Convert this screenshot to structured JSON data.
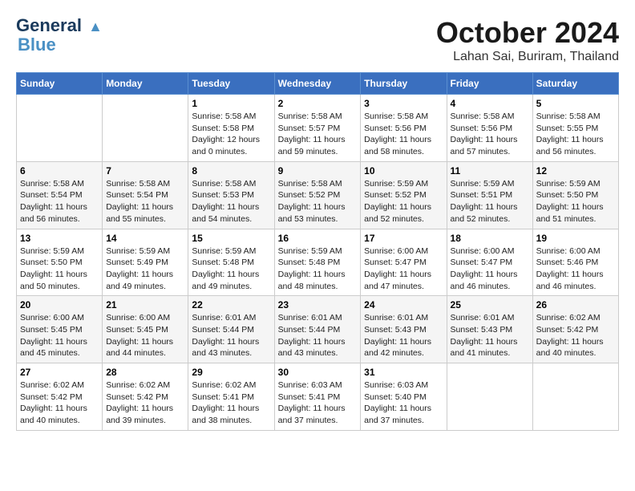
{
  "logo": {
    "line1": "General",
    "line2": "Blue"
  },
  "title": "October 2024",
  "location": "Lahan Sai, Buriram, Thailand",
  "days_of_week": [
    "Sunday",
    "Monday",
    "Tuesday",
    "Wednesday",
    "Thursday",
    "Friday",
    "Saturday"
  ],
  "weeks": [
    [
      {
        "day": "",
        "content": ""
      },
      {
        "day": "",
        "content": ""
      },
      {
        "day": "1",
        "content": "Sunrise: 5:58 AM\nSunset: 5:58 PM\nDaylight: 12 hours\nand 0 minutes."
      },
      {
        "day": "2",
        "content": "Sunrise: 5:58 AM\nSunset: 5:57 PM\nDaylight: 11 hours\nand 59 minutes."
      },
      {
        "day": "3",
        "content": "Sunrise: 5:58 AM\nSunset: 5:56 PM\nDaylight: 11 hours\nand 58 minutes."
      },
      {
        "day": "4",
        "content": "Sunrise: 5:58 AM\nSunset: 5:56 PM\nDaylight: 11 hours\nand 57 minutes."
      },
      {
        "day": "5",
        "content": "Sunrise: 5:58 AM\nSunset: 5:55 PM\nDaylight: 11 hours\nand 56 minutes."
      }
    ],
    [
      {
        "day": "6",
        "content": "Sunrise: 5:58 AM\nSunset: 5:54 PM\nDaylight: 11 hours\nand 56 minutes."
      },
      {
        "day": "7",
        "content": "Sunrise: 5:58 AM\nSunset: 5:54 PM\nDaylight: 11 hours\nand 55 minutes."
      },
      {
        "day": "8",
        "content": "Sunrise: 5:58 AM\nSunset: 5:53 PM\nDaylight: 11 hours\nand 54 minutes."
      },
      {
        "day": "9",
        "content": "Sunrise: 5:58 AM\nSunset: 5:52 PM\nDaylight: 11 hours\nand 53 minutes."
      },
      {
        "day": "10",
        "content": "Sunrise: 5:59 AM\nSunset: 5:52 PM\nDaylight: 11 hours\nand 52 minutes."
      },
      {
        "day": "11",
        "content": "Sunrise: 5:59 AM\nSunset: 5:51 PM\nDaylight: 11 hours\nand 52 minutes."
      },
      {
        "day": "12",
        "content": "Sunrise: 5:59 AM\nSunset: 5:50 PM\nDaylight: 11 hours\nand 51 minutes."
      }
    ],
    [
      {
        "day": "13",
        "content": "Sunrise: 5:59 AM\nSunset: 5:50 PM\nDaylight: 11 hours\nand 50 minutes."
      },
      {
        "day": "14",
        "content": "Sunrise: 5:59 AM\nSunset: 5:49 PM\nDaylight: 11 hours\nand 49 minutes."
      },
      {
        "day": "15",
        "content": "Sunrise: 5:59 AM\nSunset: 5:48 PM\nDaylight: 11 hours\nand 49 minutes."
      },
      {
        "day": "16",
        "content": "Sunrise: 5:59 AM\nSunset: 5:48 PM\nDaylight: 11 hours\nand 48 minutes."
      },
      {
        "day": "17",
        "content": "Sunrise: 6:00 AM\nSunset: 5:47 PM\nDaylight: 11 hours\nand 47 minutes."
      },
      {
        "day": "18",
        "content": "Sunrise: 6:00 AM\nSunset: 5:47 PM\nDaylight: 11 hours\nand 46 minutes."
      },
      {
        "day": "19",
        "content": "Sunrise: 6:00 AM\nSunset: 5:46 PM\nDaylight: 11 hours\nand 46 minutes."
      }
    ],
    [
      {
        "day": "20",
        "content": "Sunrise: 6:00 AM\nSunset: 5:45 PM\nDaylight: 11 hours\nand 45 minutes."
      },
      {
        "day": "21",
        "content": "Sunrise: 6:00 AM\nSunset: 5:45 PM\nDaylight: 11 hours\nand 44 minutes."
      },
      {
        "day": "22",
        "content": "Sunrise: 6:01 AM\nSunset: 5:44 PM\nDaylight: 11 hours\nand 43 minutes."
      },
      {
        "day": "23",
        "content": "Sunrise: 6:01 AM\nSunset: 5:44 PM\nDaylight: 11 hours\nand 43 minutes."
      },
      {
        "day": "24",
        "content": "Sunrise: 6:01 AM\nSunset: 5:43 PM\nDaylight: 11 hours\nand 42 minutes."
      },
      {
        "day": "25",
        "content": "Sunrise: 6:01 AM\nSunset: 5:43 PM\nDaylight: 11 hours\nand 41 minutes."
      },
      {
        "day": "26",
        "content": "Sunrise: 6:02 AM\nSunset: 5:42 PM\nDaylight: 11 hours\nand 40 minutes."
      }
    ],
    [
      {
        "day": "27",
        "content": "Sunrise: 6:02 AM\nSunset: 5:42 PM\nDaylight: 11 hours\nand 40 minutes."
      },
      {
        "day": "28",
        "content": "Sunrise: 6:02 AM\nSunset: 5:42 PM\nDaylight: 11 hours\nand 39 minutes."
      },
      {
        "day": "29",
        "content": "Sunrise: 6:02 AM\nSunset: 5:41 PM\nDaylight: 11 hours\nand 38 minutes."
      },
      {
        "day": "30",
        "content": "Sunrise: 6:03 AM\nSunset: 5:41 PM\nDaylight: 11 hours\nand 37 minutes."
      },
      {
        "day": "31",
        "content": "Sunrise: 6:03 AM\nSunset: 5:40 PM\nDaylight: 11 hours\nand 37 minutes."
      },
      {
        "day": "",
        "content": ""
      },
      {
        "day": "",
        "content": ""
      }
    ]
  ]
}
